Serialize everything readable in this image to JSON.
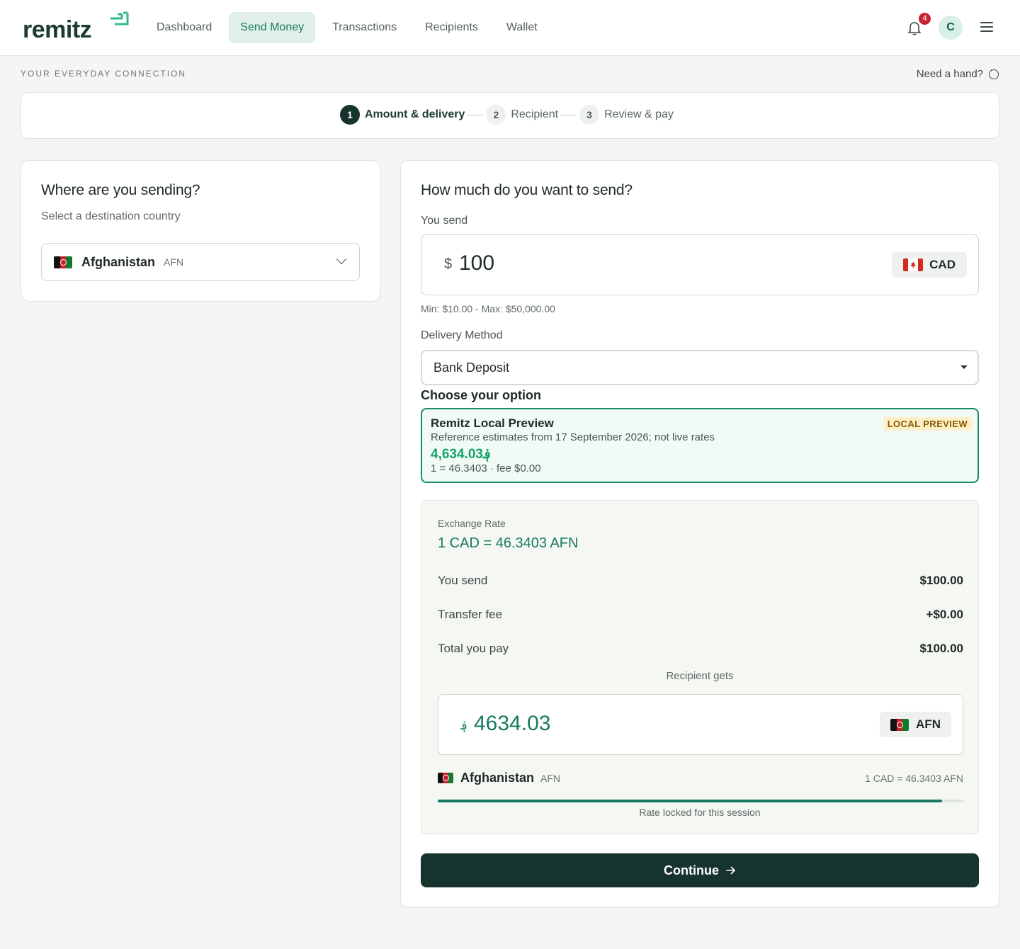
{
  "brand": {
    "name": "remitz",
    "accent": "#17795f",
    "dark": "#17332e"
  },
  "nav": {
    "items": [
      {
        "label": "Dashboard"
      },
      {
        "label": "Send Money"
      },
      {
        "label": "Transactions"
      },
      {
        "label": "Recipients"
      },
      {
        "label": "Wallet"
      }
    ],
    "notifications_count": "4",
    "avatar_initial": "C"
  },
  "tagline": "YOUR EVERYDAY CONNECTION",
  "help_label": "Need a hand?",
  "steps": [
    {
      "num": "1",
      "label": "Amount & delivery"
    },
    {
      "num": "2",
      "label": "Recipient"
    },
    {
      "num": "3",
      "label": "Review & pay"
    }
  ],
  "destination": {
    "title": "Where are you sending?",
    "subtitle": "Select a destination country",
    "country": "Afghanistan",
    "code": "AFN"
  },
  "send": {
    "title": "How much do you want to send?",
    "you_send_label": "You send",
    "currency_symbol": "$",
    "amount": "100",
    "currency": "CAD",
    "limits": "Min: $10.00 - Max: $50,000.00",
    "delivery_label": "Delivery Method",
    "delivery_value": "Bank Deposit",
    "choose_label": "Choose your option"
  },
  "option": {
    "title": "Remitz Local Preview",
    "badge": "LOCAL PREVIEW",
    "description": "Reference estimates from 17 September 2026; not live rates",
    "amount": "4,634.03؋",
    "rate_fee": "1 = 46.3403 · fee $0.00"
  },
  "summary": {
    "rate_label": "Exchange Rate",
    "rate": "1 CAD = 46.3403 AFN",
    "rows": [
      {
        "label": "You send",
        "value": "$100.00"
      },
      {
        "label": "Transfer fee",
        "value": "+$0.00"
      },
      {
        "label": "Total you pay",
        "value": "$100.00"
      }
    ],
    "recipient_gets_label": "Recipient gets",
    "recv_symbol": "؋",
    "recv_amount": "4634.03",
    "recv_currency": "AFN",
    "dest_country": "Afghanistan",
    "dest_code": "AFN",
    "dest_rate": "1 CAD = 46.3403 AFN",
    "rate_lock_progress": 0.96,
    "locked_label": "Rate locked for this session"
  },
  "continue_label": "Continue"
}
